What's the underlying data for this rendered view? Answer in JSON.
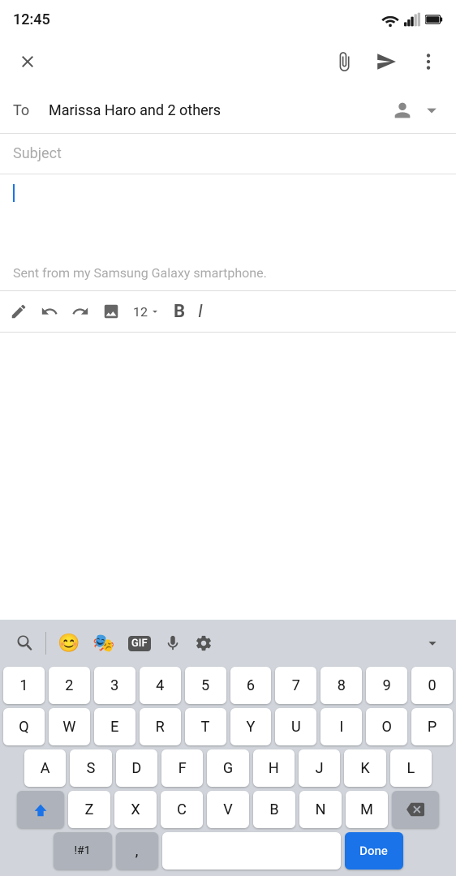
{
  "statusBar": {
    "time": "12:45"
  },
  "toolbar": {
    "closeLabel": "×",
    "attachLabel": "attach",
    "sendLabel": "send",
    "moreLabel": "⋮"
  },
  "emailFields": {
    "toLabel": "To",
    "toValue": "Marissa Haro and 2 others",
    "subjectPlaceholder": "Subject",
    "signature": "Sent from my Samsung Galaxy smartphone."
  },
  "formatToolbar": {
    "pencilIcon": "pencil",
    "undoIcon": "undo",
    "redoIcon": "redo",
    "imageIcon": "image",
    "fontSize": "12",
    "boldLabel": "B",
    "italicLabel": "I"
  },
  "keyboard": {
    "specialRow": [
      "↺",
      "😊",
      "🎭",
      "GIF",
      "🎤",
      "⚙",
      "⌄"
    ],
    "numberRow": [
      "1",
      "2",
      "3",
      "4",
      "5",
      "6",
      "7",
      "8",
      "9",
      "0"
    ],
    "row1": [
      "Q",
      "W",
      "E",
      "R",
      "T",
      "Y",
      "U",
      "I",
      "O",
      "P"
    ],
    "row2": [
      "A",
      "S",
      "D",
      "F",
      "G",
      "H",
      "J",
      "K",
      "L"
    ],
    "row3": [
      "Z",
      "X",
      "C",
      "V",
      "B",
      "N",
      "M"
    ],
    "bottomLeft": "!#1",
    "comma": ",",
    "space": "",
    "done": "Done"
  }
}
